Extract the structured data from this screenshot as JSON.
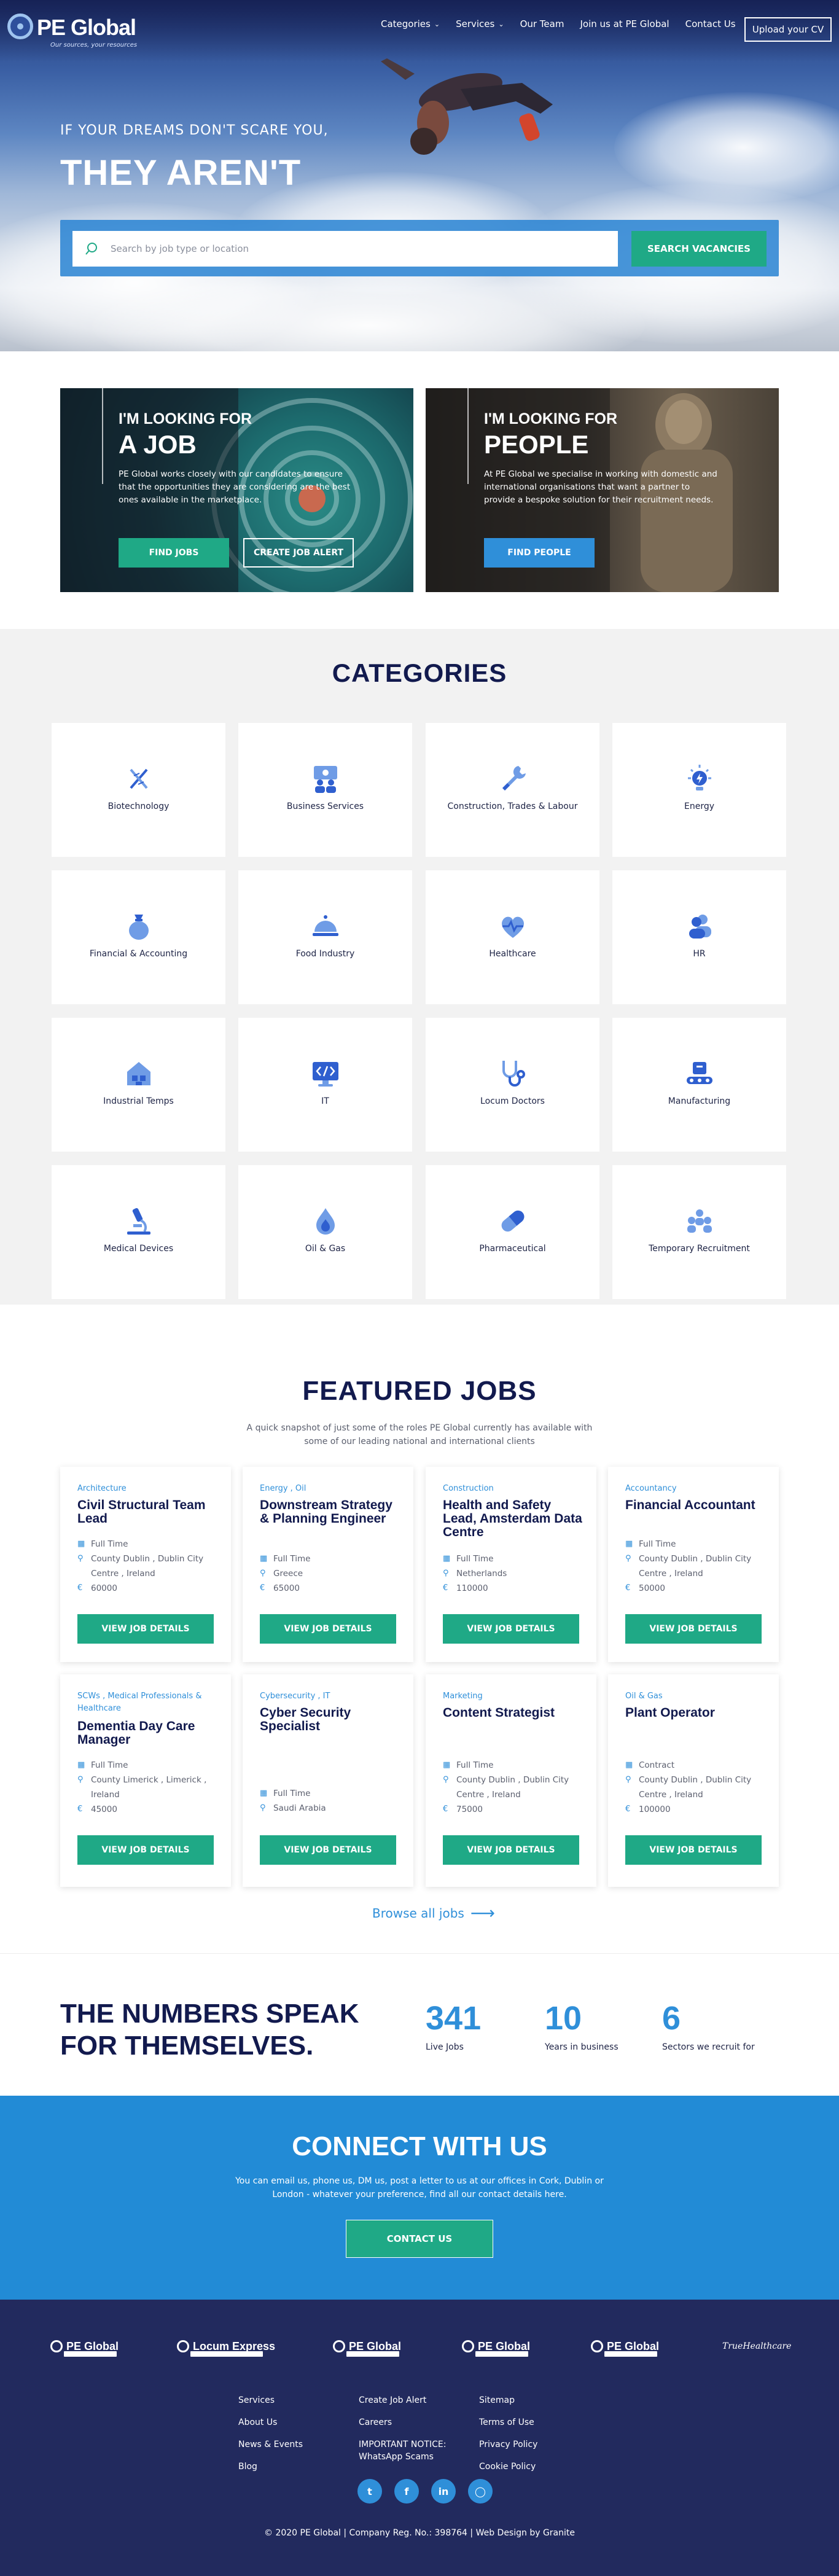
{
  "header": {
    "logo_text": "PE Global",
    "logo_tagline": "Our sources, your resources",
    "nav": [
      {
        "label": "Categories",
        "dropdown": true
      },
      {
        "label": "Services",
        "dropdown": true
      },
      {
        "label": "Our Team",
        "dropdown": false
      },
      {
        "label": "Join us at PE Global",
        "dropdown": false
      },
      {
        "label": "Contact Us",
        "dropdown": false
      }
    ],
    "cv_button": "Upload your CV"
  },
  "hero": {
    "subtitle": "If your dreams don't scare you,",
    "title": "THEY AREN'T",
    "search_placeholder": "Search by job type or location",
    "search_button": "SEARCH VACANCIES"
  },
  "looking": [
    {
      "small": "I'M LOOKING FOR",
      "big": "A JOB",
      "text": "PE Global works closely with our candidates to ensure that the opportunities they are considering are the best ones available in the marketplace.",
      "button1": "FIND JOBS",
      "button2": "CREATE JOB ALERT"
    },
    {
      "small": "I'M LOOKING FOR",
      "big": "PEOPLE",
      "text": "At PE Global we specialise in working with domestic and international organisations that want a partner to provide a bespoke solution for their recruitment needs.",
      "button1": "FIND PEOPLE"
    }
  ],
  "categories": {
    "title": "CATEGORIES",
    "items": [
      {
        "label": "Biotechnology",
        "icon": "dna-icon"
      },
      {
        "label": "Business Services",
        "icon": "business-people-icon"
      },
      {
        "label": "Construction, Trades & Labour",
        "icon": "wrench-icon"
      },
      {
        "label": "Energy",
        "icon": "energy-bulb-icon"
      },
      {
        "label": "Financial & Accounting",
        "icon": "money-bag-icon"
      },
      {
        "label": "Food Industry",
        "icon": "food-cloche-icon"
      },
      {
        "label": "Healthcare",
        "icon": "heart-pulse-icon"
      },
      {
        "label": "HR",
        "icon": "people-icon"
      },
      {
        "label": "Industrial Temps",
        "icon": "factory-icon"
      },
      {
        "label": "IT",
        "icon": "code-monitor-icon"
      },
      {
        "label": "Locum Doctors",
        "icon": "stethoscope-icon"
      },
      {
        "label": "Manufacturing",
        "icon": "conveyor-icon"
      },
      {
        "label": "Medical Devices",
        "icon": "microscope-icon"
      },
      {
        "label": "Oil & Gas",
        "icon": "flame-drop-icon"
      },
      {
        "label": "Pharmaceutical",
        "icon": "capsule-icon"
      },
      {
        "label": "Temporary Recruitment",
        "icon": "group-icon"
      }
    ]
  },
  "featured": {
    "title": "FEATURED JOBS",
    "subtitle": "A quick snapshot of just some of the roles PE Global currently has available with some of our leading national and international clients",
    "button_label": "VIEW JOB DETAILS",
    "jobs": [
      {
        "category": "Architecture",
        "title": "Civil Structural Team Lead",
        "type": "Full Time",
        "location": "County Dublin , Dublin City Centre , Ireland",
        "salary": "60000"
      },
      {
        "category": "Energy , Oil",
        "title": "Downstream Strategy & Planning Engineer",
        "type": "Full Time",
        "location": "Greece",
        "salary": "65000"
      },
      {
        "category": "Construction",
        "title": "Health and Safety Lead, Amsterdam Data Centre",
        "type": "Full Time",
        "location": "Netherlands",
        "salary": "110000"
      },
      {
        "category": "Accountancy",
        "title": "Financial Accountant",
        "type": "Full Time",
        "location": "County Dublin , Dublin City Centre , Ireland",
        "salary": "50000"
      },
      {
        "category": "SCWs , Medical Professionals & Healthcare",
        "title": "Dementia Day Care Manager",
        "type": "Full Time",
        "location": "County Limerick , Limerick , Ireland",
        "salary": "45000"
      },
      {
        "category": "Cybersecurity , IT",
        "title": "Cyber Security Specialist",
        "type": "Full Time",
        "location": "Saudi Arabia",
        "salary": ""
      },
      {
        "category": "Marketing",
        "title": "Content Strategist",
        "type": "Full Time",
        "location": "County Dublin , Dublin City Centre , Ireland",
        "salary": "75000"
      },
      {
        "category": "Oil & Gas",
        "title": "Plant Operator",
        "type": "Contract",
        "location": "County Dublin , Dublin City Centre , Ireland",
        "salary": "100000"
      }
    ],
    "browse": "Browse all jobs"
  },
  "numbers": {
    "title_line1": "THE NUMBERS SPEAK",
    "title_line2": "FOR THEMSELVES.",
    "stats": [
      {
        "value": "341",
        "label": "Live Jobs"
      },
      {
        "value": "10",
        "label": "Years in business"
      },
      {
        "value": "6",
        "label": "Sectors we recruit for"
      }
    ]
  },
  "connect": {
    "title": "CONNECT WITH US",
    "text": "You can email us, phone us, DM us, post a letter to us at our offices in Cork, Dublin or London - whatever your preference, find all our contact details here.",
    "button": "CONTACT US"
  },
  "footer": {
    "logos": [
      "PE Global",
      "Locum Express",
      "PE Global",
      "PE Global",
      "PE Global",
      "TrueHealthcare"
    ],
    "col1": [
      "Services",
      "About Us",
      "News & Events",
      "Blog"
    ],
    "col2": [
      "Create Job Alert",
      "Careers",
      "IMPORTANT NOTICE: WhatsApp Scams"
    ],
    "col3": [
      "Sitemap",
      "Terms of Use",
      "Privacy Policy",
      "Cookie Policy"
    ],
    "social": [
      "twitter-icon",
      "facebook-icon",
      "linkedin-icon",
      "instagram-icon"
    ],
    "copyright": "© 2020 PE Global | Company Reg. No.: 398764 | Web Design by Granite"
  },
  "colors": {
    "navy": "#121a4e",
    "blue": "#2f8fd9",
    "green": "#1fa986",
    "footer": "#222a5e",
    "connect": "#228bd6"
  }
}
